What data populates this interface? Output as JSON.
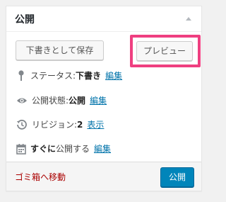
{
  "box": {
    "title": "公開",
    "toggle_icon": "triangle-up-icon"
  },
  "actions": {
    "save_draft_label": "下書きとして保存",
    "preview_label": "プレビュー"
  },
  "misc": {
    "status_label": "ステータス:",
    "status_value": "下書き",
    "status_edit": "編集",
    "visibility_label": "公開状態:",
    "visibility_value": "公開",
    "visibility_edit": "編集",
    "revisions_label": "リビジョン:",
    "revisions_value": "2",
    "revisions_link": "表示",
    "schedule_value": "すぐに",
    "schedule_label": "公開する",
    "schedule_edit": "編集"
  },
  "major": {
    "trash_label": "ゴミ箱へ移動",
    "publish_label": "公開"
  },
  "colors": {
    "highlight": "#ef3f80",
    "link": "#0073aa",
    "trash": "#aa0000",
    "primary": "#0085ba"
  }
}
